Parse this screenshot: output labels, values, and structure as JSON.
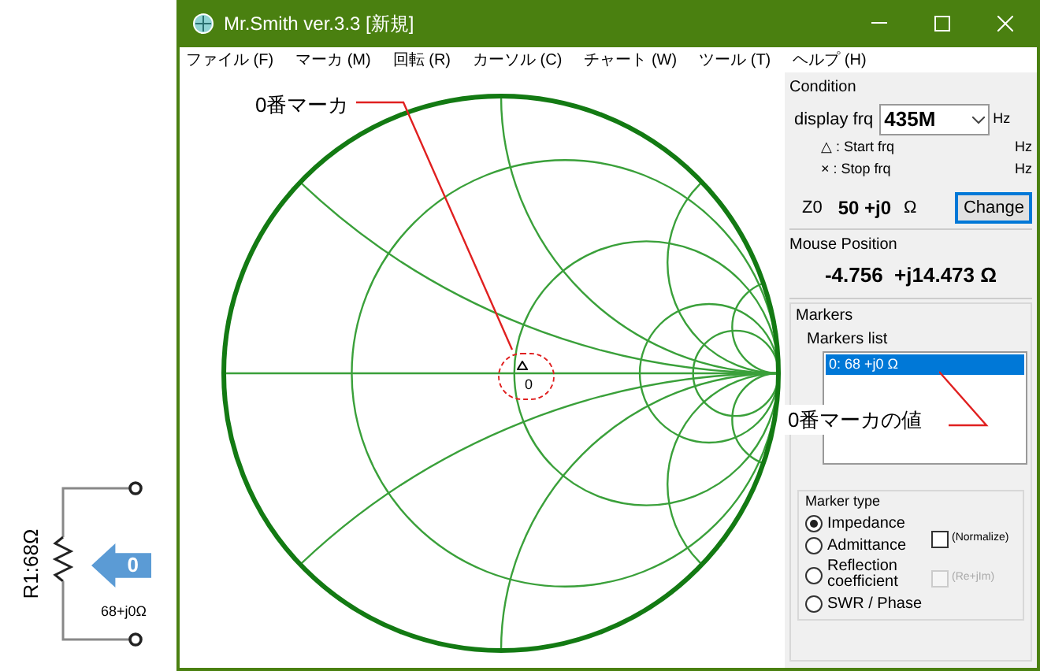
{
  "circuit": {
    "resistor_label": "R1:68Ω",
    "marker_badge": "0",
    "value": "68+j0Ω"
  },
  "window": {
    "title": "Mr.Smith ver.3.3 [新規]"
  },
  "menu": [
    {
      "label": "ファイル",
      "shortcut": "(F)"
    },
    {
      "label": "マーカ",
      "shortcut": "(M)"
    },
    {
      "label": "回転",
      "shortcut": "(R)"
    },
    {
      "label": "カーソル",
      "shortcut": "(C)"
    },
    {
      "label": "チャート",
      "shortcut": "(W)"
    },
    {
      "label": "ツール",
      "shortcut": "(T)"
    },
    {
      "label": "ヘルプ",
      "shortcut": "(H)"
    }
  ],
  "chart": {
    "marker_label": "0",
    "callout": "0番マーカ"
  },
  "condition": {
    "title": "Condition",
    "display_label": "display frq",
    "display_value": "435M",
    "display_unit": "Hz",
    "start_label": "△ : Start frq",
    "start_unit": "Hz",
    "stop_label": "× : Stop frq",
    "stop_unit": "Hz",
    "z0_label": "Z0",
    "z0_value": "50 +j0",
    "z0_unit": "Ω",
    "change_button": "Change"
  },
  "mouse_position": {
    "title": "Mouse Position",
    "value": "-4.756  +j14.473 Ω"
  },
  "markers": {
    "title": "Markers",
    "list_title": "Markers list",
    "items": [
      {
        "label": "0: 68 +j0 Ω",
        "selected": true
      }
    ],
    "callout": "0番マーカの値"
  },
  "marker_type": {
    "title": "Marker type",
    "options": [
      {
        "label": "Impedance",
        "selected": true
      },
      {
        "label": "Admittance",
        "selected": false
      },
      {
        "label": "Reflection coefficient",
        "selected": false
      },
      {
        "label": "SWR / Phase",
        "selected": false
      }
    ],
    "checkboxes": [
      {
        "label": "(Normalize)",
        "checked": false,
        "disabled": false
      },
      {
        "label": "(Re+jIm)",
        "checked": false,
        "disabled": true
      }
    ]
  }
}
